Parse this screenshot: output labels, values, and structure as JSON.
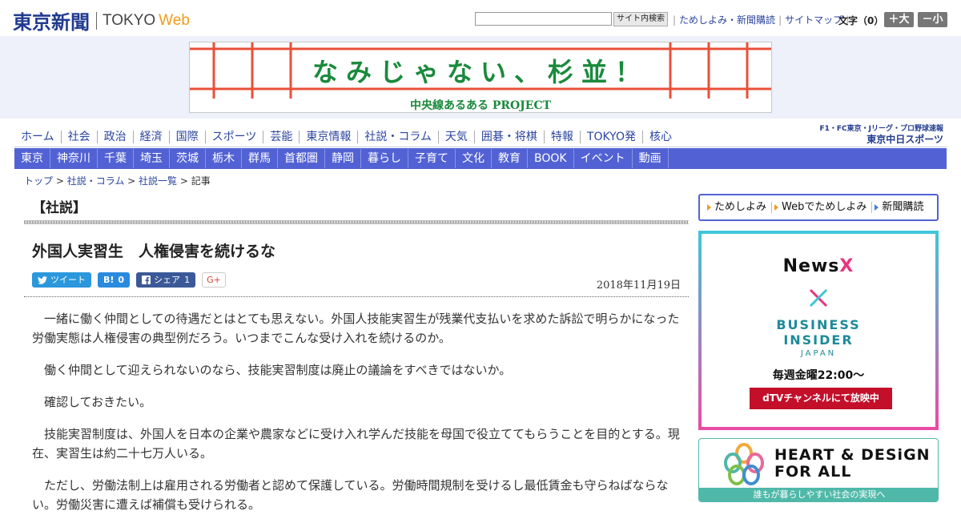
{
  "header": {
    "logo_name": "東京新聞",
    "logo_tokyo": "TOKYO",
    "logo_web": "Web",
    "search_placeholder": "",
    "search_button": "サイト内検索",
    "links": [
      "ためしよみ・新聞購読",
      "サイトマップ"
    ],
    "font_label": "文字（0）",
    "font_up": "＋大",
    "font_down": "－小"
  },
  "banner": {
    "title": "なみじゃない、杉並！",
    "subtitle": "中央線あるある PROJECT"
  },
  "nav_primary": [
    "ホーム",
    "社会",
    "政治",
    "経済",
    "国際",
    "スポーツ",
    "芸能",
    "東京情報",
    "社説・コラム",
    "天気",
    "囲碁・将棋",
    "特報",
    "TOKYO発",
    "核心"
  ],
  "sports_logo": {
    "line1": "F1・FC東京・Jリーグ・プロ野球速報",
    "line2": "東京中日スポーツ"
  },
  "nav_secondary": [
    "東京",
    "神奈川",
    "千葉",
    "埼玉",
    "茨城",
    "栃木",
    "群馬",
    "首都圏",
    "静岡",
    "暮らし",
    "子育て",
    "文化",
    "教育",
    "BOOK",
    "イベント",
    "動画"
  ],
  "breadcrumb": {
    "top": "トップ",
    "col": "社説・コラム",
    "list": "社説一覧",
    "current": "記事",
    "sep": " > "
  },
  "article": {
    "section": "【社説】",
    "title": "外国人実習生　人権侵害を続けるな",
    "date": "2018年11月19日",
    "share": {
      "tweet": "ツイート",
      "hatena_count": "0",
      "facebook": "シェア",
      "facebook_count": "1",
      "gplus": "G+"
    },
    "paragraphs": [
      "一緒に働く仲間としての待遇だとはとても思えない。外国人技能実習生が残業代支払いを求めた訴訟で明らかになった労働実態は人権侵害の典型例だろう。いつまでこんな受け入れを続けるのか。",
      "働く仲間として迎えられないのなら、技能実習制度は廃止の議論をすべきではないか。",
      "確認しておきたい。",
      "技能実習制度は、外国人を日本の企業や農家などに受け入れ学んだ技能を母国で役立ててもらうことを目的とする。現在、実習生は約二十七万人いる。",
      "ただし、労働法制上は雇用される労働者と認めて保護している。労働時間規制を受けるし最低賃金も守らねばならない。労働災害に遭えば補償も受けられる。"
    ]
  },
  "sidebar": {
    "nav": [
      "ためしよみ",
      "Webでためしよみ",
      "新聞購読"
    ],
    "ad1": {
      "news": "News",
      "x": "X",
      "bi1": "BUSINESS",
      "bi2": "INSIDER",
      "japan": "JAPAN",
      "time": "毎週金曜22:00〜",
      "dtv": "dTVチャンネルにて放映中"
    },
    "ad2": {
      "line1": "HEART & DESiGN",
      "line2": "FOR ALL",
      "bar": "誰もが暮らしやすい社会の実現へ"
    }
  },
  "colors": {
    "brand_blue": "#213a8f",
    "nav_blue": "#5262d4",
    "accent_orange": "#f39a1b",
    "banner_green": "#1a8a3c",
    "twitter": "#2b97dc",
    "hatena": "#2a8bde",
    "facebook": "#3b5998",
    "dtv_red": "#c40f2a"
  }
}
